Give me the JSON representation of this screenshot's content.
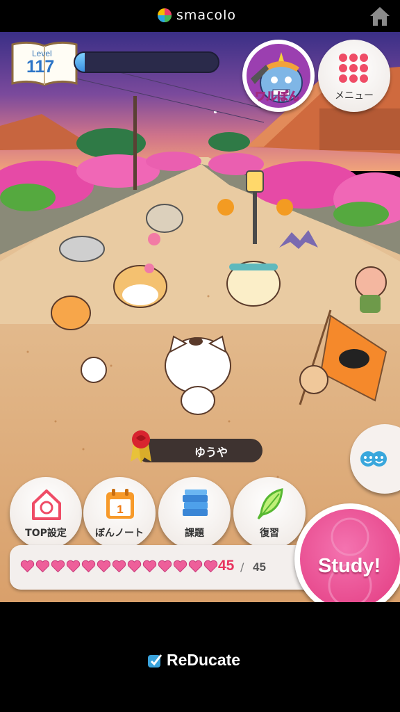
{
  "header": {
    "brand": "smacolo"
  },
  "level": {
    "label": "Level",
    "value": "117",
    "progress_fraction": 0.07
  },
  "top_buttons": {
    "warupon_label": "ワルぽん",
    "menu_label": "メニュー"
  },
  "player": {
    "name": "ゆうや"
  },
  "nav": [
    {
      "label": "TOP設定",
      "icon": "house-gear-icon"
    },
    {
      "label": "ぼんノート",
      "icon": "calendar-icon",
      "badge": "1"
    },
    {
      "label": "課題",
      "icon": "books-icon"
    },
    {
      "label": "復習",
      "icon": "feather-icon"
    }
  ],
  "hearts": {
    "current": "45",
    "separator": "/",
    "max": "45"
  },
  "study": {
    "label": "Study!"
  },
  "footer": {
    "brand": "ReDucate"
  },
  "colors": {
    "accent_pink": "#e2397f",
    "level_blue": "#2b74c6",
    "heart": "#e8345f"
  }
}
